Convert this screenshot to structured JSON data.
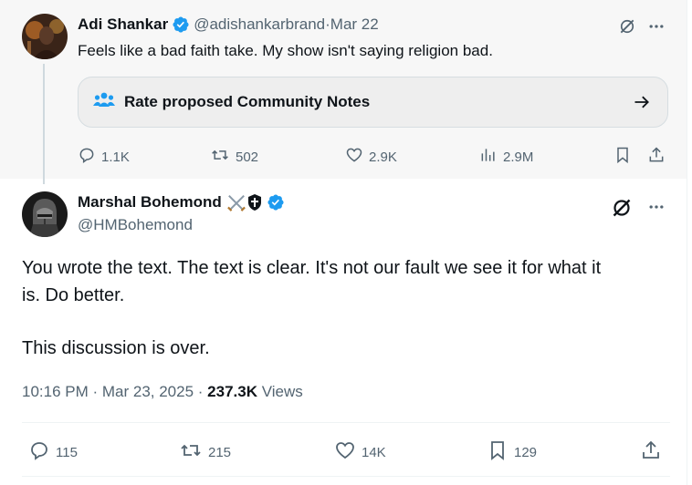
{
  "parent_tweet": {
    "name": "Adi Shankar",
    "handle": "@adishankarbrand",
    "separator": " · ",
    "date": "Mar 22",
    "text": "Feels like a bad faith take. My show isn't saying religion bad.",
    "community_notes_label": "Rate proposed Community Notes",
    "stats": {
      "replies": "1.1K",
      "reposts": "502",
      "likes": "2.9K",
      "views": "2.9M"
    }
  },
  "main_tweet": {
    "name": "Marshal Bohemond",
    "name_emoji": "⚔️⛨",
    "handle": "@HMBohemond",
    "text_line1": "You wrote the text. The text is clear. It's not our fault we see it for what it",
    "text_line2": "is. Do better.",
    "text_line3": "This discussion is over.",
    "time": "10:16 PM",
    "date": "Mar 23, 2025",
    "meta_sep": " · ",
    "views_count": "237.3K",
    "views_label": " Views",
    "stats": {
      "replies": "115",
      "reposts": "215",
      "likes": "14K",
      "bookmarks": "129"
    }
  },
  "colors": {
    "verified": "#1d9bf0",
    "muted": "#536471",
    "text": "#0f1419",
    "notes_icon": "#1d9bf0"
  }
}
